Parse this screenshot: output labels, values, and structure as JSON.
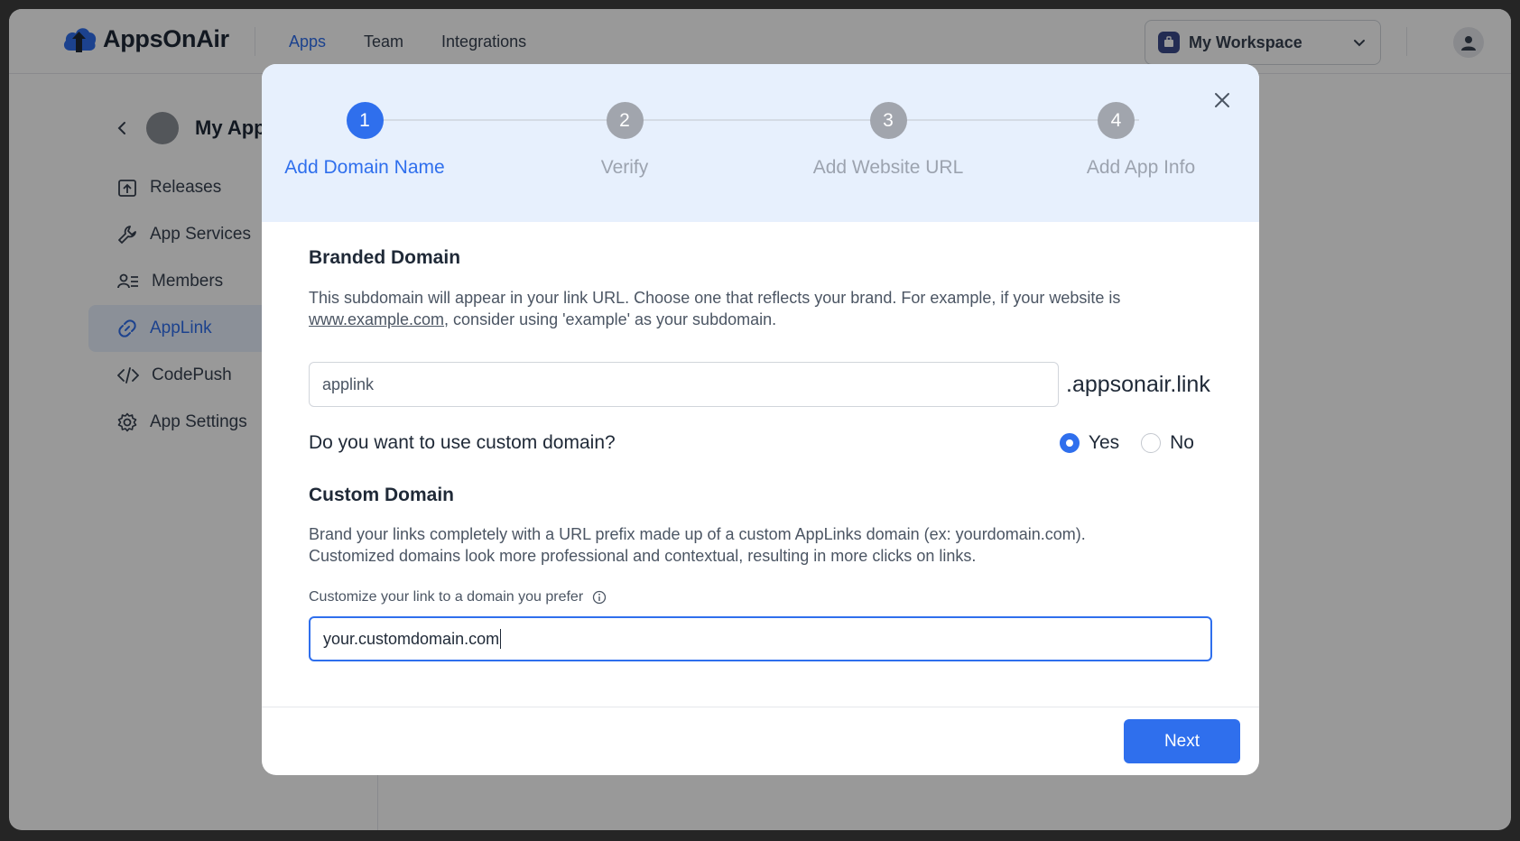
{
  "topbar": {
    "brand": "AppsOnAir",
    "nav": [
      {
        "label": "Apps",
        "active": true
      },
      {
        "label": "Team",
        "active": false
      },
      {
        "label": "Integrations",
        "active": false
      }
    ],
    "workspace_label": "My Workspace"
  },
  "sidebar": {
    "app_name": "My App",
    "items": [
      {
        "label": "Releases",
        "icon": "upload-box-icon"
      },
      {
        "label": "App Services",
        "icon": "wrench-icon"
      },
      {
        "label": "Members",
        "icon": "members-icon"
      },
      {
        "label": "AppLink",
        "icon": "link-icon",
        "active": true
      },
      {
        "label": "CodePush",
        "icon": "code-icon"
      },
      {
        "label": "App Settings",
        "icon": "gear-icon"
      }
    ]
  },
  "modal": {
    "steps": [
      {
        "number": "1",
        "label": "Add Domain Name",
        "active": true
      },
      {
        "number": "2",
        "label": "Verify",
        "active": false
      },
      {
        "number": "3",
        "label": "Add Website URL",
        "active": false
      },
      {
        "number": "4",
        "label": "Add App Info",
        "active": false
      }
    ],
    "branded": {
      "title": "Branded Domain",
      "desc_before": "This subdomain will appear in your link URL. Choose one that reflects your brand. For example, if your website is",
      "desc_link": "www.example.com",
      "desc_after": ", consider using 'example' as your subdomain.",
      "subdomain_value": "applink",
      "suffix": ".appsonair.link"
    },
    "question": {
      "text": "Do you want to use custom domain?",
      "options": [
        "Yes",
        "No"
      ],
      "selected": "Yes"
    },
    "custom": {
      "title": "Custom Domain",
      "desc_line1": "Brand your links completely with a URL prefix made up of a custom AppLinks domain (ex: yourdomain.com).",
      "desc_line2": "Customized domains look more professional and contextual, resulting in more clicks on links.",
      "field_label": "Customize your link to a domain you prefer",
      "field_value": "your.customdomain.com"
    },
    "next_label": "Next"
  },
  "colors": {
    "accent": "#2f6fed",
    "header_bg": "#e7f0fd",
    "inactive_step": "#a1a5ad"
  }
}
